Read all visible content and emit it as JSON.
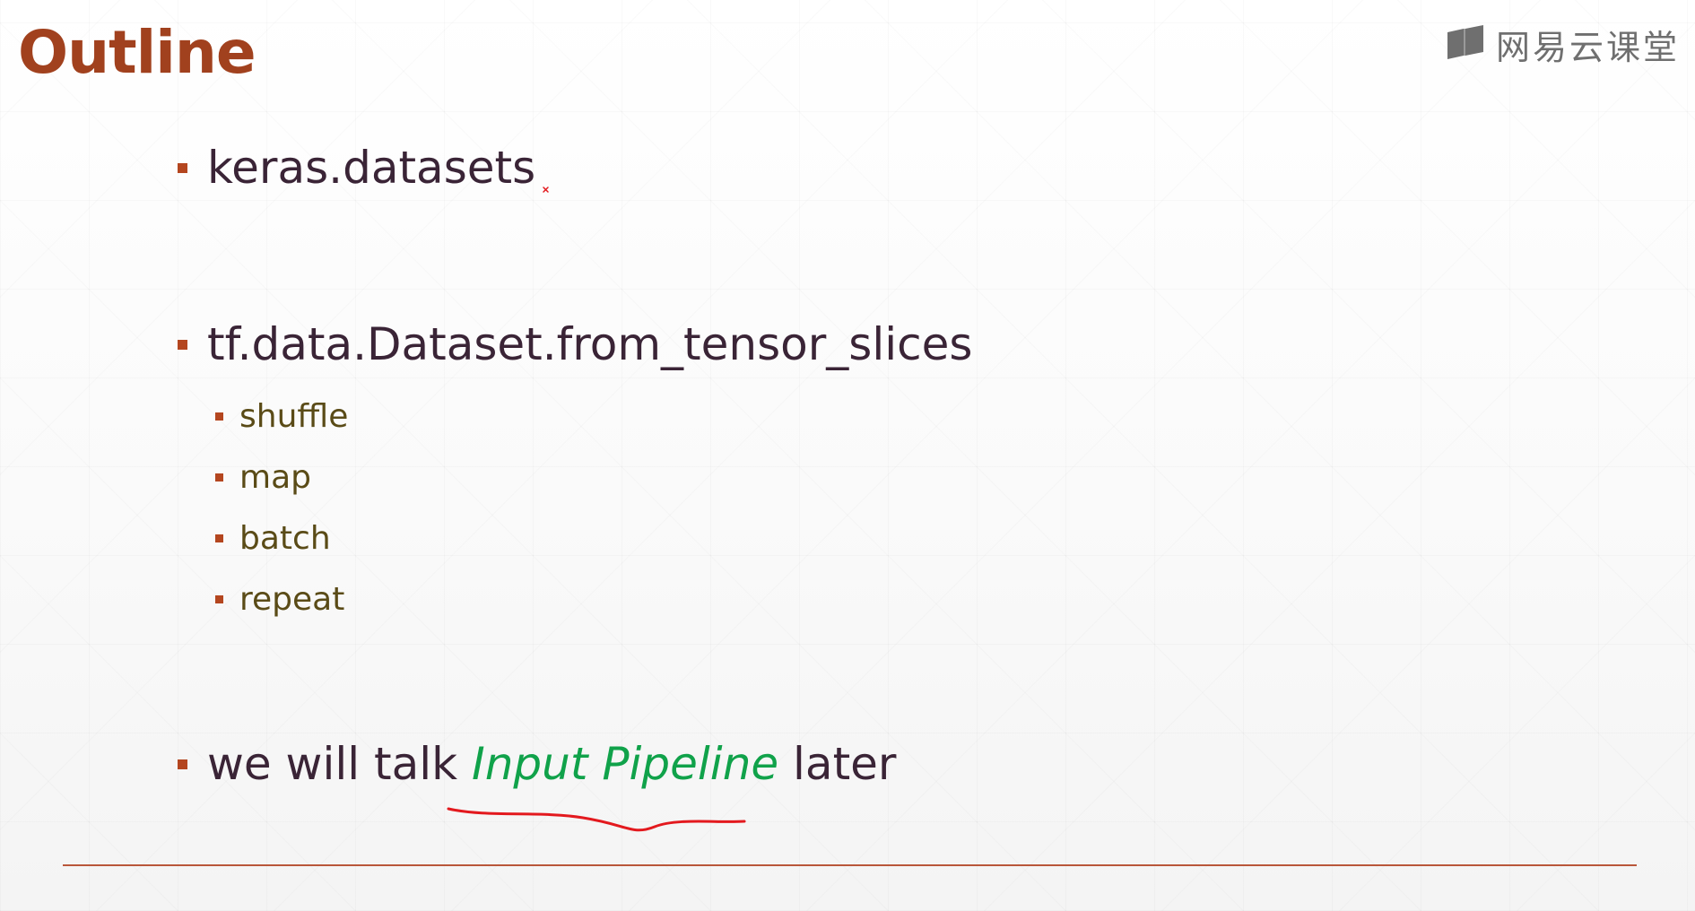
{
  "slide": {
    "title": "Outline",
    "logo_text": "网易云课堂",
    "bullets": [
      {
        "text": "keras.datasets"
      },
      {
        "text": "tf.data.Dataset.from_tensor_slices",
        "sub": [
          "shuffle",
          "map",
          "batch",
          "repeat"
        ]
      },
      {
        "before": "we will talk ",
        "highlight": "Input Pipeline",
        "after": " later"
      }
    ]
  },
  "colors": {
    "title": "#a1411e",
    "bullet_marker": "#b4461f",
    "body_text": "#3a2436",
    "sub_text": "#5a4b17",
    "highlight": "#10a24a",
    "pen_annotation": "#e3191e",
    "rule": "#b9573a"
  },
  "icons": [
    "book-icon"
  ]
}
